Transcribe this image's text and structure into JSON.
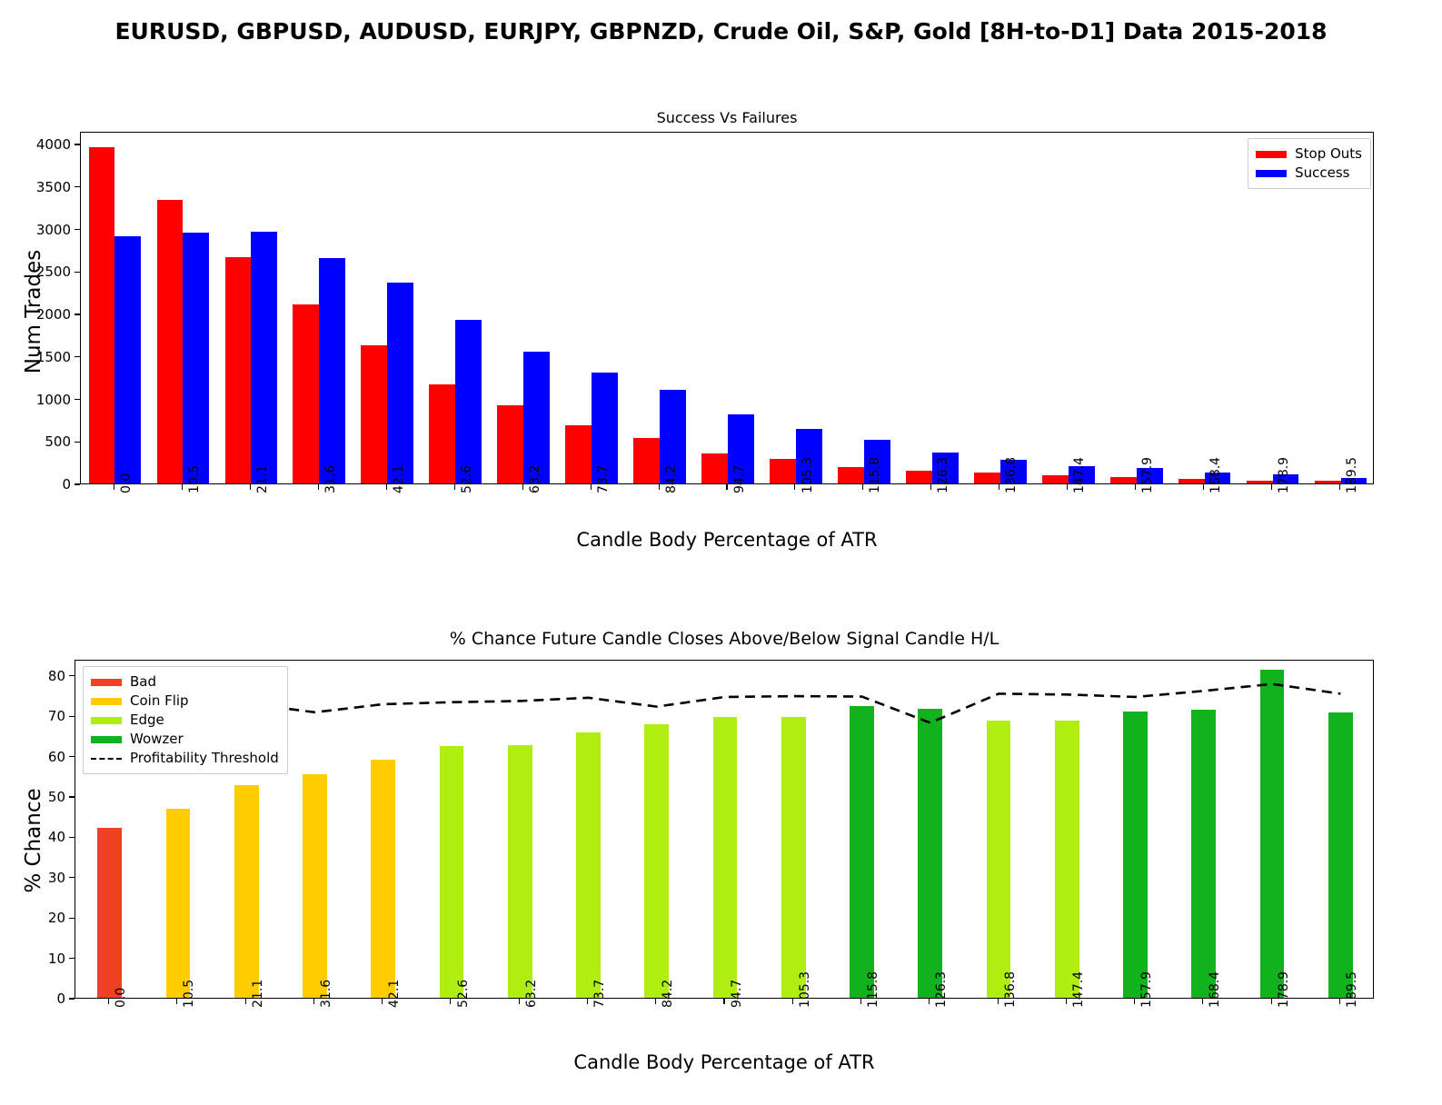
{
  "suptitle": "EURUSD, GBPUSD, AUDUSD, EURJPY, GBPNZD, Crude Oil, S&P, Gold [8H-to-D1] Data 2015-2018",
  "colors": {
    "stop_outs": "#FF0000",
    "success": "#0000FF",
    "bad": "#EF4123",
    "coin_flip": "#FFCC00",
    "edge": "#B0EE11",
    "wowzer": "#11B21E",
    "threshold": "#000000"
  },
  "chart_data": [
    {
      "id": "success_vs_failures",
      "type": "bar",
      "title": "Success Vs Failures",
      "xlabel": "Candle Body Percentage of ATR",
      "ylabel": "Num Trades",
      "ylim": [
        0,
        4150
      ],
      "yticks": [
        0,
        500,
        1000,
        1500,
        2000,
        2500,
        3000,
        3500,
        4000
      ],
      "grid": false,
      "legend_position": "upper right",
      "categories": [
        "0.0",
        "10.5",
        "21.1",
        "31.6",
        "42.1",
        "52.6",
        "63.2",
        "73.7",
        "84.2",
        "94.7",
        "105.3",
        "115.8",
        "126.3",
        "136.8",
        "147.4",
        "157.9",
        "168.4",
        "178.9",
        "189.5"
      ],
      "series": [
        {
          "name": "Stop Outs",
          "color": "#FF0000",
          "values": [
            3955,
            3335,
            2665,
            2110,
            1625,
            1170,
            925,
            680,
            530,
            355,
            285,
            190,
            145,
            125,
            95,
            70,
            50,
            30,
            30
          ]
        },
        {
          "name": "Success",
          "color": "#0000FF",
          "values": [
            2910,
            2955,
            2965,
            2650,
            2360,
            1930,
            1550,
            1300,
            1105,
            810,
            645,
            515,
            365,
            275,
            200,
            185,
            125,
            110,
            65
          ]
        }
      ]
    },
    {
      "id": "pct_chance",
      "type": "bar",
      "title": "% Chance Future Candle Closes Above/Below Signal Candle H/L",
      "xlabel": "Candle Body Percentage of ATR",
      "ylabel": "% Chance",
      "ylim": [
        0,
        84
      ],
      "yticks": [
        0,
        10,
        20,
        30,
        40,
        50,
        60,
        70,
        80
      ],
      "grid": false,
      "legend_position": "upper left",
      "categories": [
        "0.0",
        "10.5",
        "21.1",
        "31.6",
        "42.1",
        "52.6",
        "63.2",
        "73.7",
        "84.2",
        "94.7",
        "105.3",
        "115.8",
        "126.3",
        "136.8",
        "147.4",
        "157.9",
        "168.4",
        "178.9",
        "189.5"
      ],
      "values": [
        42.2,
        46.8,
        52.7,
        55.5,
        59.0,
        62.3,
        62.6,
        65.8,
        67.9,
        69.7,
        69.5,
        72.3,
        71.7,
        68.8,
        68.6,
        70.9,
        71.3,
        81.2,
        70.7
      ],
      "bar_categories": [
        "Bad",
        "Coin Flip",
        "Coin Flip",
        "Coin Flip",
        "Coin Flip",
        "Edge",
        "Edge",
        "Edge",
        "Edge",
        "Edge",
        "Edge",
        "Wowzer",
        "Wowzer",
        "Edge",
        "Edge",
        "Wowzer",
        "Wowzer",
        "Wowzer",
        "Wowzer"
      ],
      "threshold_name": "Profitability Threshold",
      "threshold_values": [
        72.8,
        73.0,
        73.4,
        71.2,
        73.2,
        73.7,
        74.0,
        74.8,
        72.6,
        75.0,
        75.2,
        75.1,
        68.6,
        75.8,
        75.6,
        75.0,
        76.5,
        78.2,
        75.8
      ],
      "legend_entries": [
        {
          "label": "Bad",
          "color": "#EF4123",
          "style": "solid"
        },
        {
          "label": "Coin Flip",
          "color": "#FFCC00",
          "style": "solid"
        },
        {
          "label": "Edge",
          "color": "#B0EE11",
          "style": "solid"
        },
        {
          "label": "Wowzer",
          "color": "#11B21E",
          "style": "solid"
        },
        {
          "label": "Profitability Threshold",
          "color": "#000000",
          "style": "dashed"
        }
      ]
    }
  ]
}
